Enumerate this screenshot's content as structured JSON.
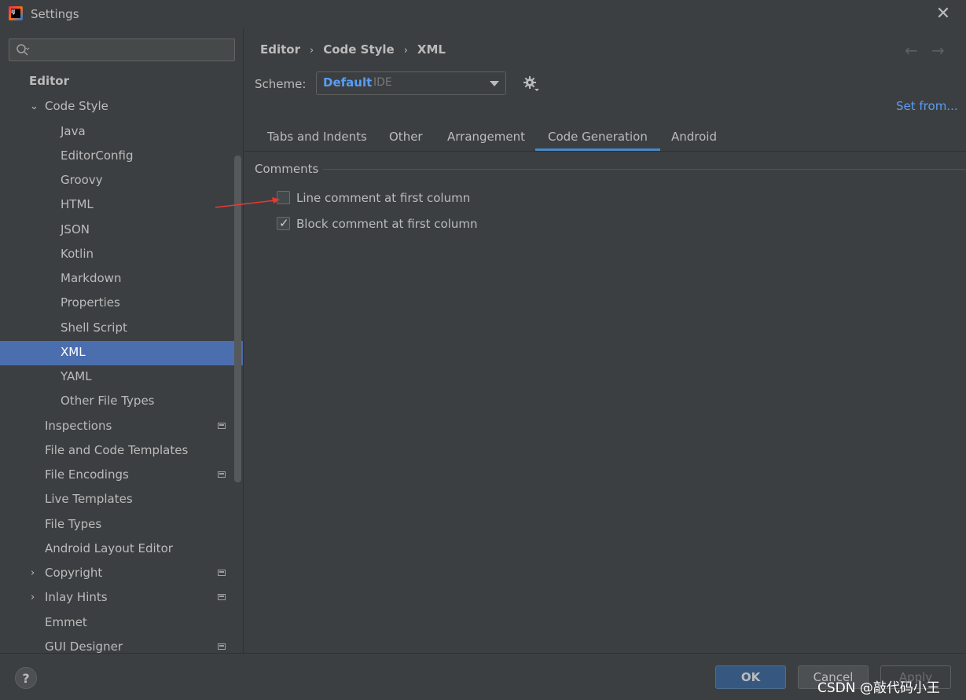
{
  "window": {
    "title": "Settings"
  },
  "search": {
    "placeholder": ""
  },
  "sidebar": {
    "items": [
      {
        "label": "Editor"
      },
      {
        "label": "Code Style"
      },
      {
        "label": "Java"
      },
      {
        "label": "EditorConfig"
      },
      {
        "label": "Groovy"
      },
      {
        "label": "HTML"
      },
      {
        "label": "JSON"
      },
      {
        "label": "Kotlin"
      },
      {
        "label": "Markdown"
      },
      {
        "label": "Properties"
      },
      {
        "label": "Shell Script"
      },
      {
        "label": "XML"
      },
      {
        "label": "YAML"
      },
      {
        "label": "Other File Types"
      },
      {
        "label": "Inspections"
      },
      {
        "label": "File and Code Templates"
      },
      {
        "label": "File Encodings"
      },
      {
        "label": "Live Templates"
      },
      {
        "label": "File Types"
      },
      {
        "label": "Android Layout Editor"
      },
      {
        "label": "Copyright"
      },
      {
        "label": "Inlay Hints"
      },
      {
        "label": "Emmet"
      },
      {
        "label": "GUI Designer"
      }
    ],
    "selected": "XML"
  },
  "breadcrumb": [
    "Editor",
    "Code Style",
    "XML"
  ],
  "scheme": {
    "label": "Scheme:",
    "value": "Default",
    "suffix": "IDE"
  },
  "set_from": "Set from...",
  "tabs": [
    "Tabs and Indents",
    "Other",
    "Arrangement",
    "Code Generation",
    "Android"
  ],
  "active_tab": "Code Generation",
  "comments": {
    "title": "Comments",
    "line_comment": {
      "label": "Line comment at first column",
      "checked": false
    },
    "block_comment": {
      "label": "Block comment at first column",
      "checked": true
    }
  },
  "footer": {
    "help": "?",
    "ok": "OK",
    "cancel": "Cancel",
    "apply": "Apply"
  },
  "watermark": "CSDN @敲代码小王",
  "colors": {
    "accent": "#4b6eaf",
    "link": "#589df6",
    "annotation_arrow": "#e53935"
  }
}
